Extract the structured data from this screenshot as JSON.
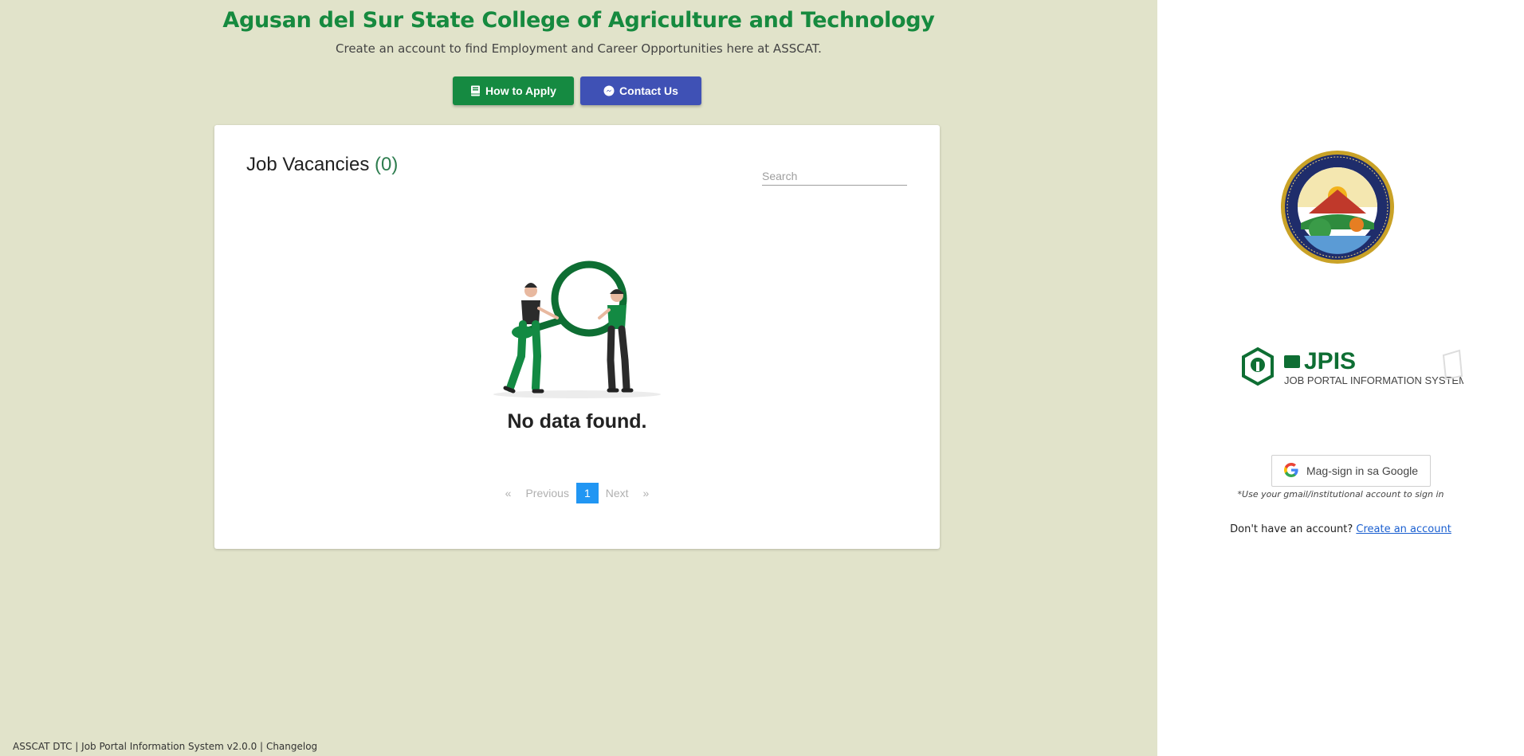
{
  "header": {
    "title": "Agusan del Sur State College of Agriculture and Technology",
    "subtitle": "Create an account to find Employment and Career Opportunities here at ASSCAT.",
    "how_to_apply_label": "How to Apply",
    "contact_us_label": "Contact Us"
  },
  "vacancies": {
    "title": "Job Vacancies",
    "count": "(0)",
    "search_placeholder": "Search",
    "empty_message": "No data found."
  },
  "pagination": {
    "prev_arrow": "«",
    "previous": "Previous",
    "current_page": "1",
    "next": "Next",
    "next_arrow": "»"
  },
  "footer": {
    "text": "ASSCAT DTC | Job Portal Information System v2.0.0 |",
    "changelog": "Changelog"
  },
  "login": {
    "logo_text": "JPIS",
    "logo_subtext": "JOB PORTAL INFORMATION SYSTEM",
    "google_button_label": "Mag-sign in sa Google",
    "gmail_note": "*Use your gmail/institutional account to sign in",
    "no_account_text": "Don't have an account?",
    "create_account_link": "Create an account"
  },
  "colors": {
    "brand_green": "#168a3f",
    "contact_blue": "#3f51b5",
    "left_background": "#e1e3ca",
    "pagination_active": "#2196f3"
  }
}
